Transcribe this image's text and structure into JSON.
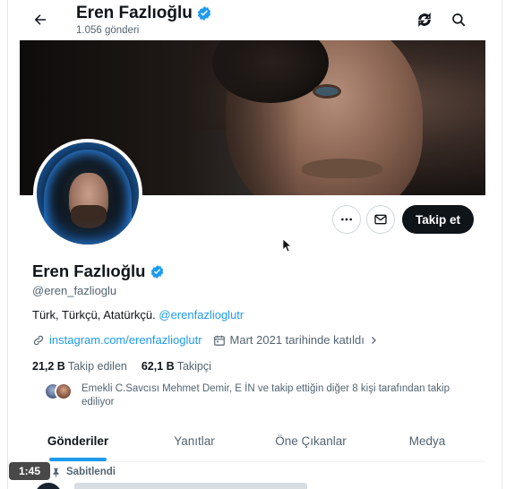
{
  "header": {
    "name": "Eren Fazlıoğlu",
    "post_count": "1.056 gönderi",
    "back_icon": "arrow-left-icon",
    "sync_icon": "sync-icon",
    "search_icon": "search-icon"
  },
  "profile": {
    "name": "Eren Fazlıoğlu",
    "handle": "@eren_fazlioglu",
    "bio_text": "Türk, Türkçü, Atatürkçü.",
    "bio_link": "@erenfazlioglutr",
    "website": "instagram.com/erenfazlioglutr",
    "joined": "Mart 2021 tarihinde katıldı",
    "following_count": "21,2 B",
    "following_label": "Takip edilen",
    "followers_count": "62,1 B",
    "followers_label": "Takipçi",
    "followed_by_text": "Emekli C.Savcısı Mehmet Demir, E İN ve takip ettiğin diğer 8 kişi tarafından takip ediliyor"
  },
  "actions": {
    "follow_label": "Takip et",
    "more_icon": "more-icon",
    "mail_icon": "mail-icon"
  },
  "tabs": [
    {
      "label": "Gönderiler",
      "active": true
    },
    {
      "label": "Yanıtlar",
      "active": false
    },
    {
      "label": "Öne Çıkanlar",
      "active": false
    },
    {
      "label": "Medya",
      "active": false
    }
  ],
  "pinned_label": "Sabitlendi",
  "video_timestamp": "1:45",
  "colors": {
    "accent": "#1d9bf0",
    "text_primary": "#0f1419",
    "text_secondary": "#536471",
    "verified": "#1d9bf0"
  }
}
